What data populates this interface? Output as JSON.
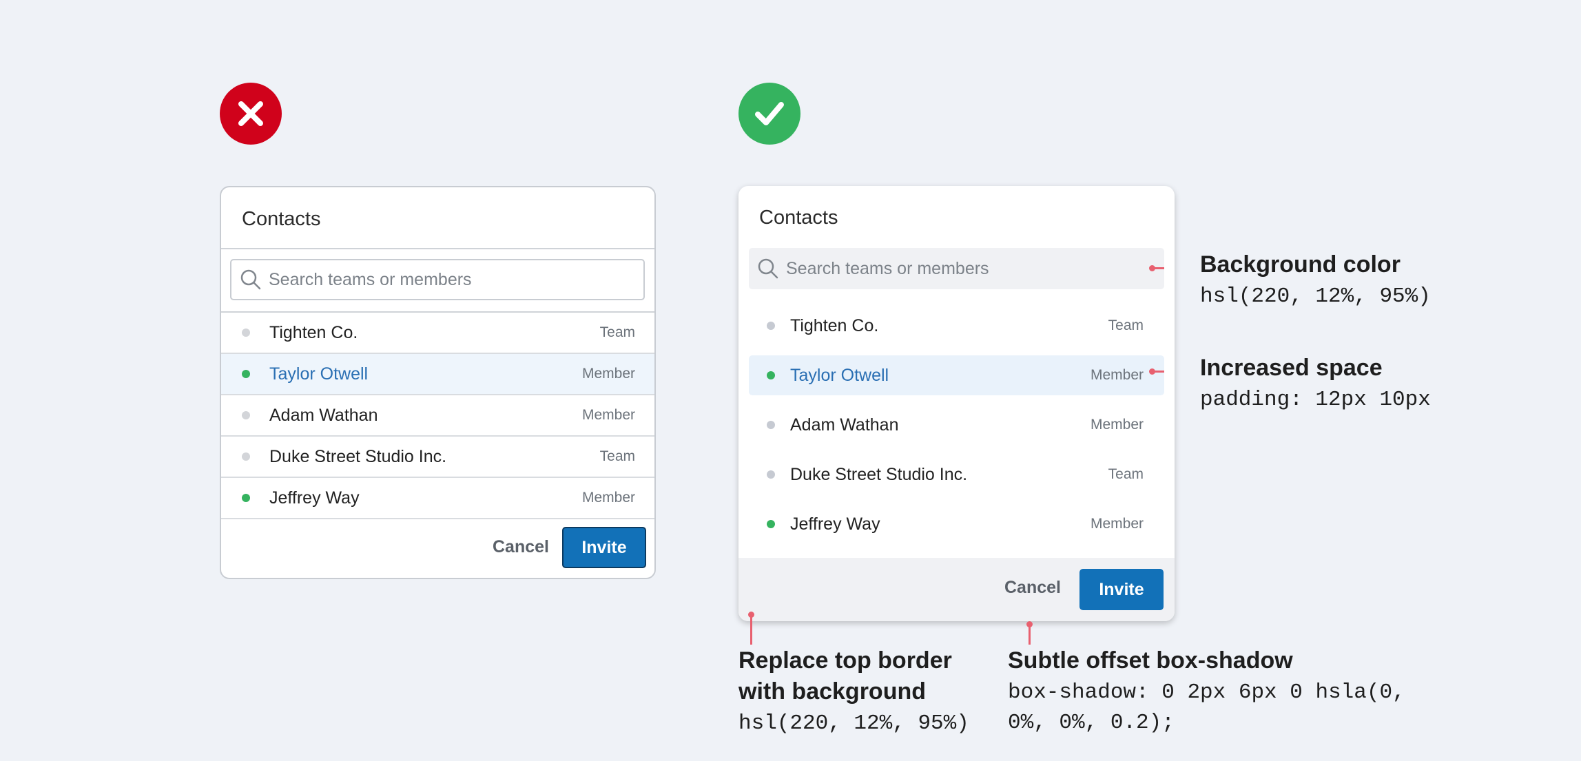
{
  "bad_example": {
    "title": "Contacts",
    "search": {
      "placeholder": "Search teams or members"
    },
    "contacts": [
      {
        "name": "Tighten Co.",
        "kind": "Team",
        "online": false,
        "selected": false
      },
      {
        "name": "Taylor Otwell",
        "kind": "Member",
        "online": true,
        "selected": true
      },
      {
        "name": "Adam Wathan",
        "kind": "Member",
        "online": false,
        "selected": false
      },
      {
        "name": "Duke Street Studio Inc.",
        "kind": "Team",
        "online": false,
        "selected": false
      },
      {
        "name": "Jeffrey Way",
        "kind": "Member",
        "online": true,
        "selected": false
      }
    ],
    "cancel_label": "Cancel",
    "invite_label": "Invite"
  },
  "good_example": {
    "title": "Contacts",
    "search": {
      "placeholder": "Search teams or members"
    },
    "contacts": [
      {
        "name": "Tighten Co.",
        "kind": "Team",
        "online": false,
        "selected": false
      },
      {
        "name": "Taylor Otwell",
        "kind": "Member",
        "online": true,
        "selected": true
      },
      {
        "name": "Adam Wathan",
        "kind": "Member",
        "online": false,
        "selected": false
      },
      {
        "name": "Duke Street Studio Inc.",
        "kind": "Team",
        "online": false,
        "selected": false
      },
      {
        "name": "Jeffrey Way",
        "kind": "Member",
        "online": true,
        "selected": false
      }
    ],
    "cancel_label": "Cancel",
    "invite_label": "Invite"
  },
  "annotations": {
    "background": {
      "title": "Background color",
      "code": "hsl(220, 12%, 95%)"
    },
    "space": {
      "title": "Increased space",
      "code": "padding: 12px 10px"
    },
    "border": {
      "title_line1": "Replace top border",
      "title_line2": "with background",
      "code": "hsl(220, 12%, 95%)"
    },
    "shadow": {
      "title": "Subtle offset box-shadow",
      "code_line1": "box-shadow: 0 2px 6px 0 hsla(0,",
      "code_line2": "0%, 0%, 0.2);"
    }
  },
  "colors": {
    "page_bg": "#eff2f7",
    "bad_badge": "#d0021b",
    "good_badge": "#35b35f",
    "accent": "#1271b8",
    "selected_text": "#2a6fb3",
    "online": "#35b35f",
    "annotation": "#e8606f"
  },
  "icons": [
    "close-icon",
    "check-icon",
    "search-icon",
    "status-dot-icon"
  ]
}
